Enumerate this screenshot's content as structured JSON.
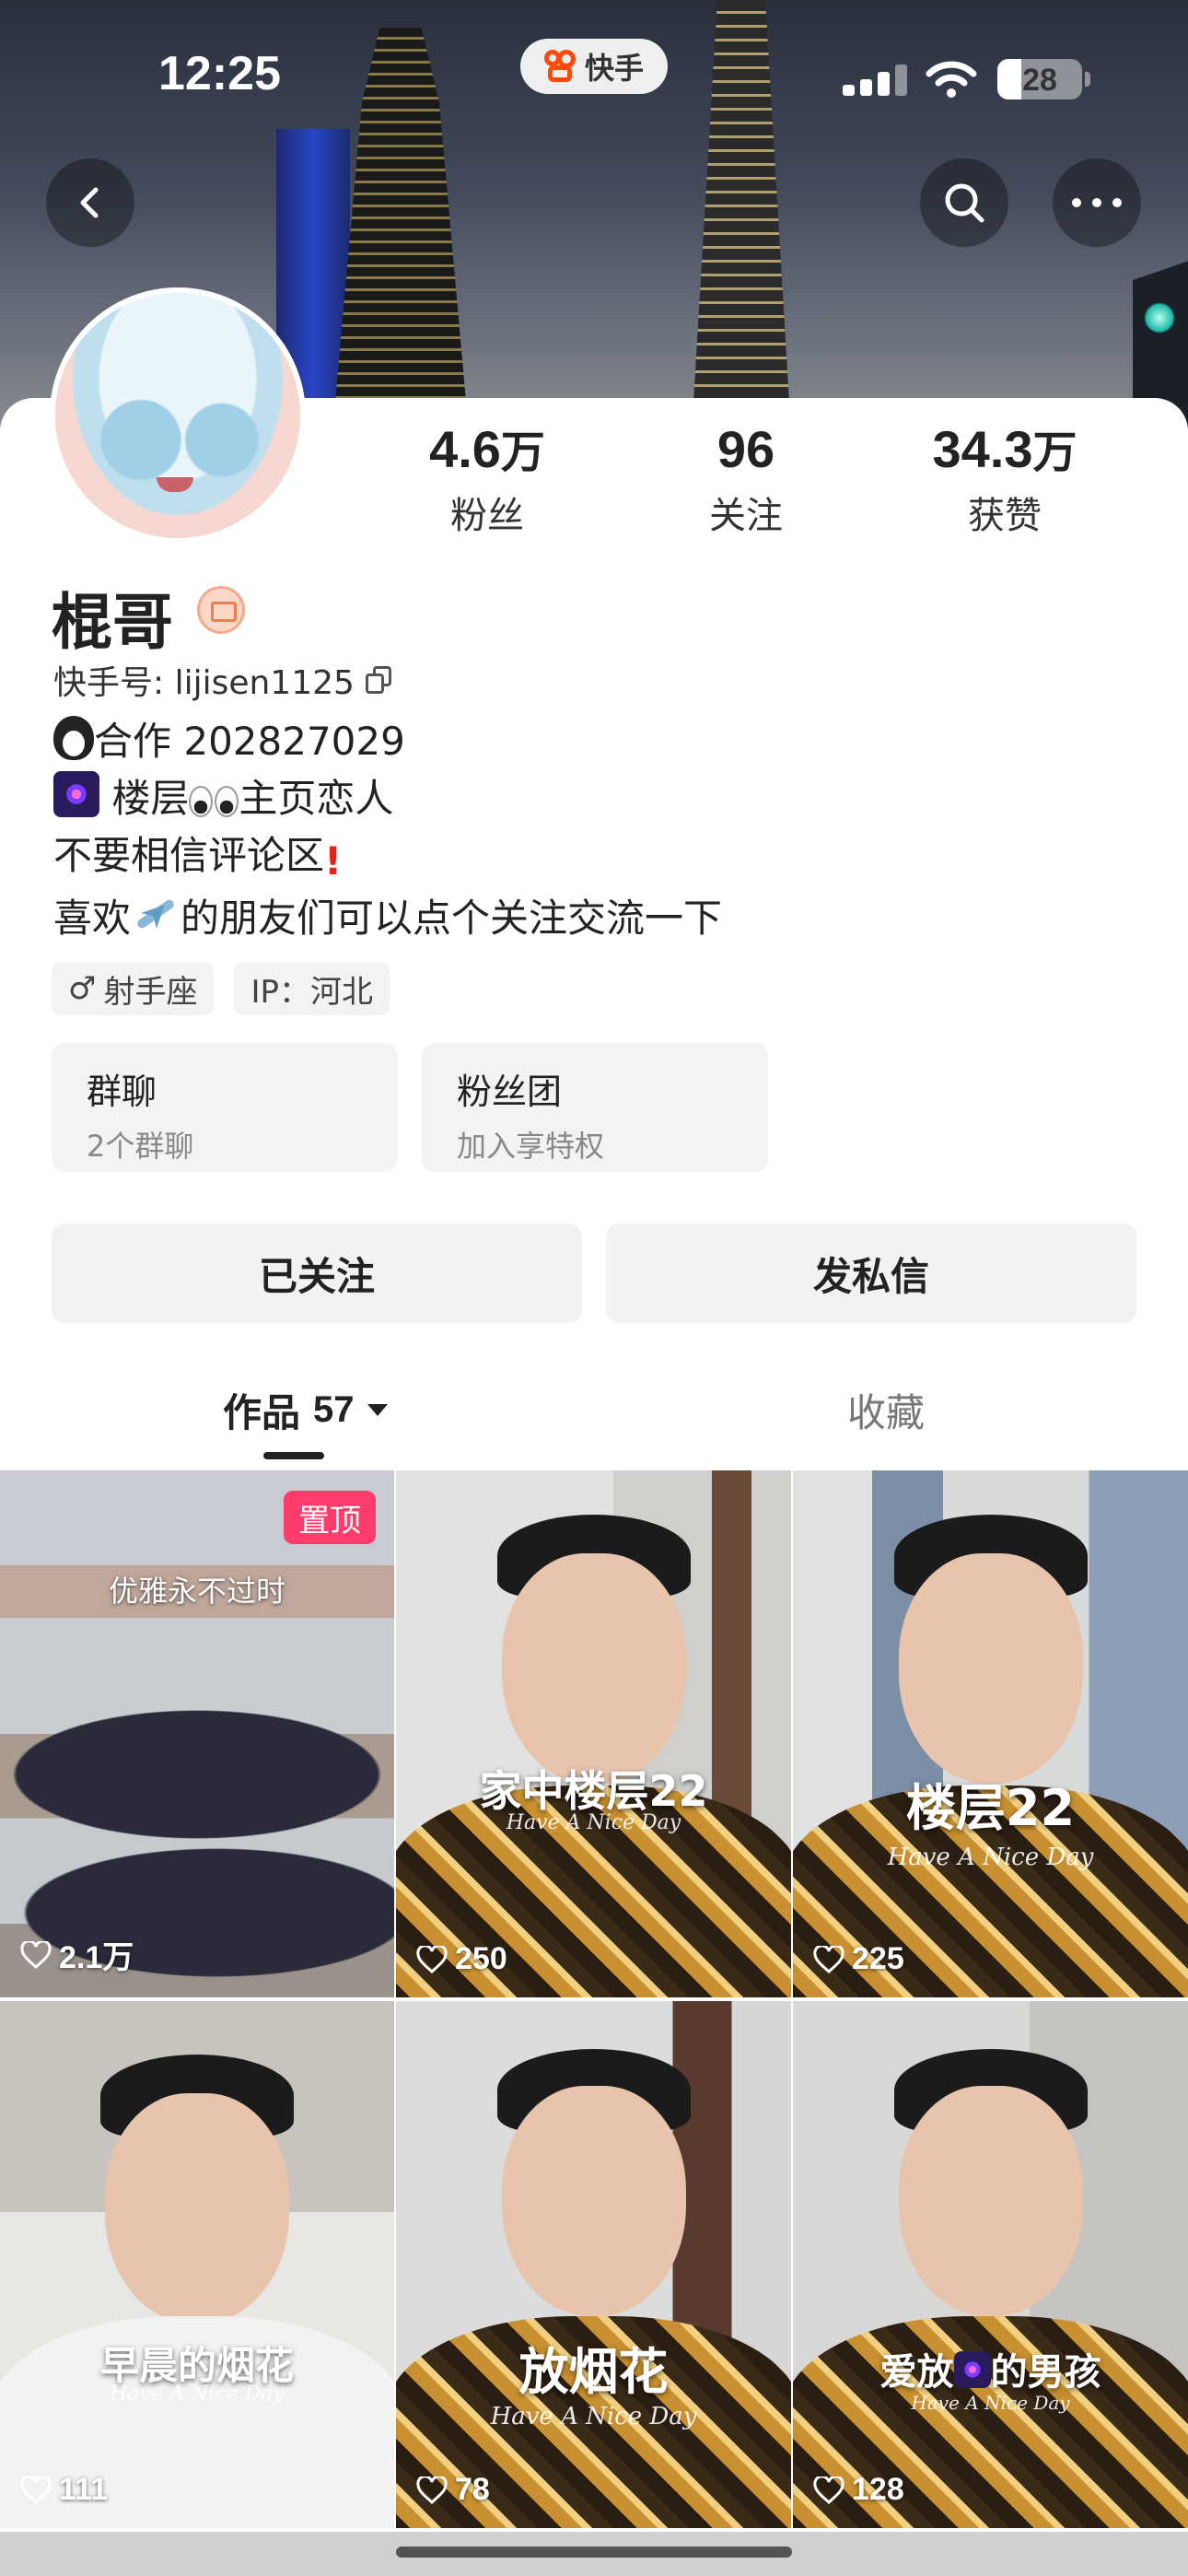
{
  "status_bar": {
    "time": "12:25",
    "app_name": "快手",
    "battery": "28"
  },
  "header": {
    "back_icon": "chevron-left-icon",
    "search_icon": "search-icon",
    "more_icon": "more-horizontal-icon"
  },
  "profile": {
    "name": "棍哥",
    "kuaishou_id": "快手号: lijisen1125",
    "stats": [
      {
        "value": "4.6",
        "unit": "万",
        "label": "粉丝"
      },
      {
        "value": "96",
        "unit": "",
        "label": "关注"
      },
      {
        "value": "34.3",
        "unit": "万",
        "label": "获赞"
      }
    ],
    "bio": [
      {
        "emoji": "penguin",
        "text": "合作 202827029"
      },
      {
        "emoji": "fireworks",
        "text_a": "楼层",
        "emoji_b": "eyes",
        "text_b": "主页恋人"
      },
      {
        "text": "不要相信评论区",
        "emoji": "exclamation",
        "mark": "!"
      },
      {
        "text_a": "喜欢",
        "emoji": "airplane",
        "text_b": "的朋友们可以点个关注交流一下"
      }
    ],
    "tags": [
      {
        "icon": "male-icon",
        "symbol": "♂",
        "text": "射手座"
      },
      {
        "text": "IP：河北"
      }
    ],
    "feature_cards": [
      {
        "title": "群聊",
        "subtitle": "2个群聊"
      },
      {
        "title": "粉丝团",
        "subtitle": "加入享特权"
      }
    ],
    "follow_button": "已关注",
    "message_button": "发私信"
  },
  "tabs": {
    "works_label": "作品",
    "works_count": "57",
    "favorites_label": "收藏"
  },
  "videos": [
    {
      "caption": "",
      "overlay": "优雅永不过时",
      "pinned": "置顶",
      "likes": "2.1万",
      "subtitle": ""
    },
    {
      "caption": "家中楼层22",
      "overlay": "",
      "pinned": "",
      "likes": "250",
      "subtitle": "Have A Nice Day"
    },
    {
      "caption": "楼层22",
      "overlay": "",
      "pinned": "",
      "likes": "225",
      "subtitle": "Have A Nice Day"
    },
    {
      "caption": "早晨的烟花",
      "overlay": "",
      "pinned": "",
      "likes": "111",
      "subtitle": "Have A Nice Day"
    },
    {
      "caption": "放烟花",
      "overlay": "",
      "pinned": "",
      "likes": "78",
      "subtitle": "Have A Nice Day"
    },
    {
      "caption_a": "爱放",
      "caption_b": "的男孩",
      "overlay": "",
      "pinned": "",
      "likes": "128",
      "subtitle": "Have A Nice Day"
    }
  ],
  "colors": {
    "accent": "#ff4906",
    "pin_badge": "#ff3c6b",
    "card_bg": "#f3f3f3",
    "text": "#222222"
  }
}
